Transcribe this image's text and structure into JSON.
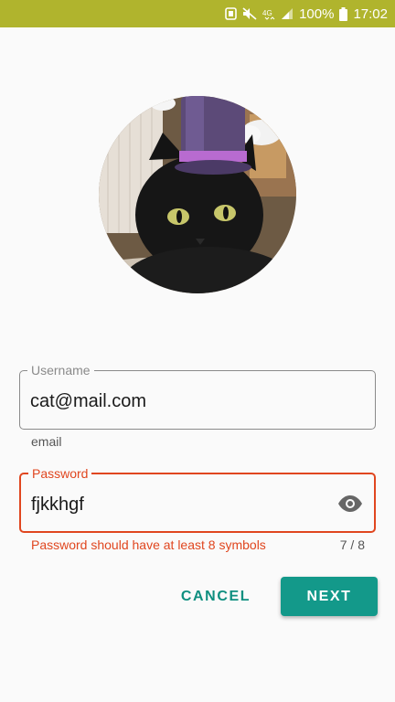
{
  "status_bar": {
    "battery": "100%",
    "time": "17:02",
    "network": "4G",
    "icons": [
      "notification-icon",
      "mute-icon",
      "network-4g-icon",
      "signal-icon",
      "battery-icon"
    ]
  },
  "avatar": {
    "description": "cat-with-top-hat-avatar"
  },
  "username": {
    "label": "Username",
    "value": "cat@mail.com",
    "helper": "email"
  },
  "password": {
    "label": "Password",
    "value": "fjkkhgf",
    "error": "Password should have at least 8 symbols",
    "counter": "7 / 8",
    "toggle_icon": "eye-icon"
  },
  "actions": {
    "cancel_label": "CANCEL",
    "next_label": "NEXT"
  },
  "colors": {
    "status_bar": "#b0b42d",
    "accent": "#13998a",
    "error": "#e0461f"
  }
}
